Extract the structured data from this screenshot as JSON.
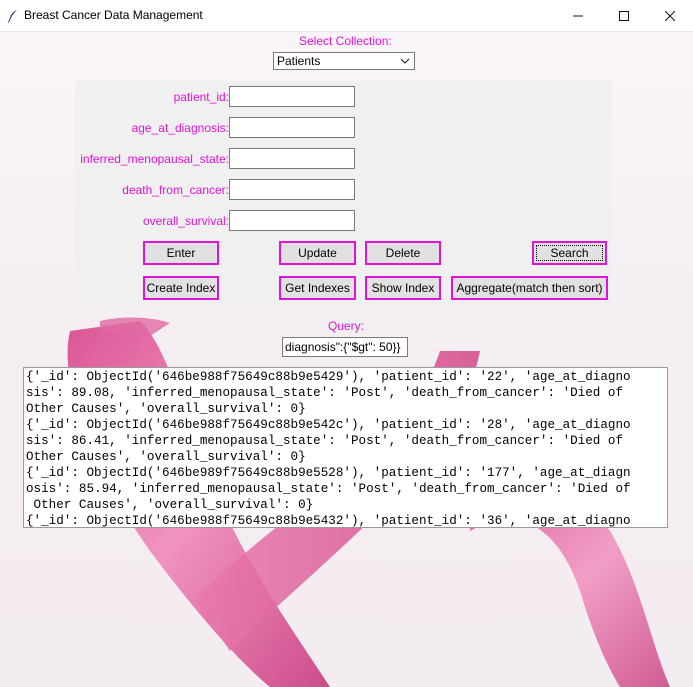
{
  "window": {
    "title": "Breast Cancer Data Management",
    "controls": {
      "minimize": "–",
      "maximize": "☐",
      "close": "✕"
    }
  },
  "collection": {
    "label": "Select Collection:",
    "selected": "Patients"
  },
  "form": {
    "fields": [
      {
        "label": "patient_id:",
        "value": ""
      },
      {
        "label": "age_at_diagnosis:",
        "value": ""
      },
      {
        "label": "inferred_menopausal_state:",
        "value": ""
      },
      {
        "label": "death_from_cancer:",
        "value": ""
      },
      {
        "label": "overall_survival:",
        "value": ""
      }
    ]
  },
  "buttons": {
    "enter": "Enter",
    "update": "Update",
    "delete": "Delete",
    "search": "Search",
    "create_index": "Create Index",
    "get_indexes": "Get Indexes",
    "show_index": "Show Index",
    "aggregate": "Aggregate(match then sort)"
  },
  "query": {
    "label": "Query:",
    "value": "diagnosis\":{\"$gt\": 50}}"
  },
  "results": {
    "lines": [
      "{'_id': ObjectId('646be988f75649c88b9e5429'), 'patient_id': '22', 'age_at_diagno",
      "sis': 89.08, 'inferred_menopausal_state': 'Post', 'death_from_cancer': 'Died of",
      "Other Causes', 'overall_survival': 0}",
      "{'_id': ObjectId('646be988f75649c88b9e542c'), 'patient_id': '28', 'age_at_diagno",
      "sis': 86.41, 'inferred_menopausal_state': 'Post', 'death_from_cancer': 'Died of",
      "Other Causes', 'overall_survival': 0}",
      "{'_id': ObjectId('646be989f75649c88b9e5528'), 'patient_id': '177', 'age_at_diagn",
      "osis': 85.94, 'inferred_menopausal_state': 'Post', 'death_from_cancer': 'Died of",
      " Other Causes', 'overall_survival': 0}",
      "{'_id': ObjectId('646be988f75649c88b9e5432'), 'patient_id': '36', 'age_at_diagno"
    ]
  },
  "colors": {
    "accent": "#e014d9",
    "panel": "#f0f0f0",
    "ribbon": "#e26aa6"
  }
}
